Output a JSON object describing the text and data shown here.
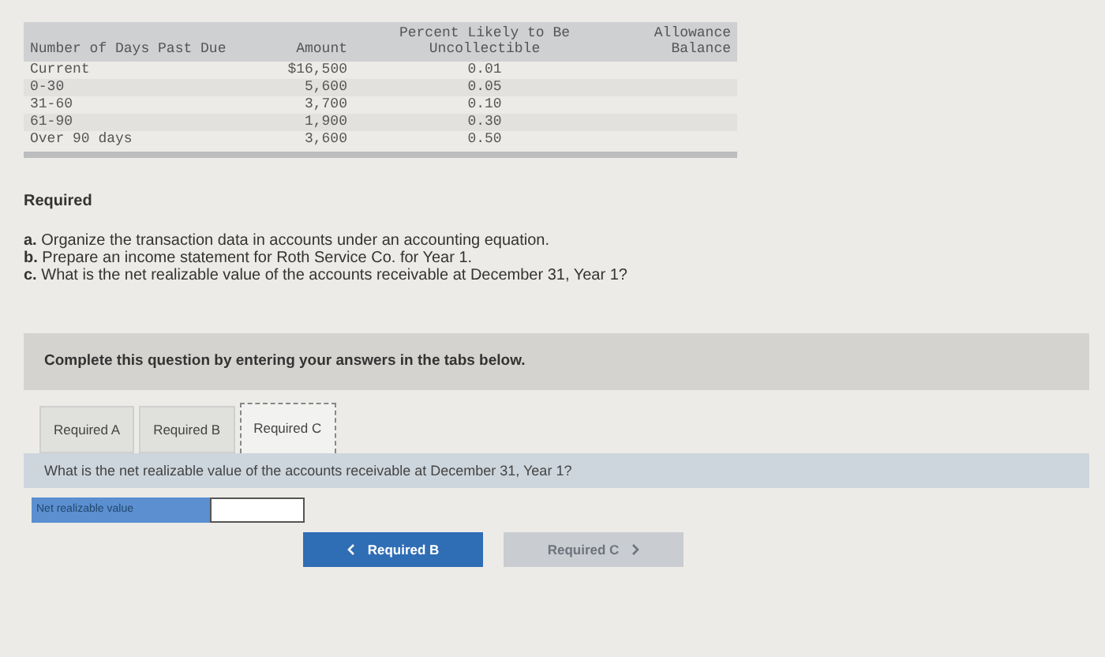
{
  "table": {
    "columns": [
      {
        "label": "Number of Days Past Due"
      },
      {
        "label": "Amount"
      },
      {
        "label": "Percent Likely to Be Uncollectible"
      },
      {
        "label": "Allowance Balance"
      }
    ],
    "rows": [
      [
        "Current",
        "$16,500",
        "0.01"
      ],
      [
        "0-30",
        "5,600",
        "0.05"
      ],
      [
        "31-60",
        "3,700",
        "0.10"
      ],
      [
        "61-90",
        "1,900",
        "0.30"
      ],
      [
        "Over 90 days",
        "3,600",
        "0.50"
      ]
    ]
  },
  "required": {
    "heading": "Required",
    "items": [
      {
        "letter": "a.",
        "text": "Organize the transaction data in accounts under an accounting equation."
      },
      {
        "letter": "b.",
        "text": "Prepare an income statement for Roth Service Co. for Year 1."
      },
      {
        "letter": "c.",
        "text": "What is the net realizable value of the accounts receivable at December 31, Year 1?"
      }
    ]
  },
  "banner": "Complete this question by entering your answers in the tabs below.",
  "tabs": [
    {
      "label": "Required A",
      "selected": false
    },
    {
      "label": "Required B",
      "selected": false
    },
    {
      "label": "Required C",
      "selected": true
    }
  ],
  "question": "What is the net realizable value of the accounts receivable at December 31, Year 1?",
  "answer": {
    "label": "Net realizable value"
  },
  "nav": [
    {
      "kind": "prev",
      "label": "Required B",
      "disabled": false
    },
    {
      "kind": "next",
      "label": "Required C",
      "disabled": true
    }
  ]
}
